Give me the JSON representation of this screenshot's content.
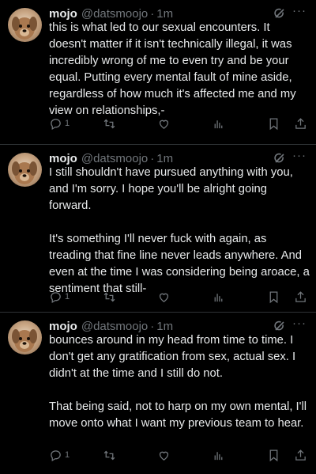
{
  "tweets": [
    {
      "name": "mojo",
      "handle": "@datsmoojo",
      "separator": "·",
      "time": "1m",
      "more": "···",
      "text": "this is what led to our sexual encounters. It doesn't matter if it isn't technically illegal, it was incredibly wrong of me to even try and be your equal. Putting every mental fault of mine aside, regardless of how much it's affected me and my view on relationships,-",
      "reply_count": "1"
    },
    {
      "name": "mojo",
      "handle": "@datsmoojo",
      "separator": "·",
      "time": "1m",
      "more": "···",
      "text": "I still shouldn't have pursued anything with you, and I'm sorry. I hope you'll be alright going forward.\n\nIt's something I'll never fuck with again, as treading that fine line never leads anywhere. And even at the time I was considering being aroace, a sentiment that still-",
      "reply_count": "1"
    },
    {
      "name": "mojo",
      "handle": "@datsmoojo",
      "separator": "·",
      "time": "1m",
      "more": "···",
      "text": "bounces around in my head from time to time. I don't get any gratification from sex, actual sex. I didn't at the time and I still do not.\n\nThat being said, not to harp on my own mental, I'll move onto what I want my previous team to hear.",
      "reply_count": "1"
    }
  ],
  "colors": {
    "background": "#000000",
    "text": "#e7e9ea",
    "muted": "#71767b",
    "divider": "#2f3336"
  },
  "icons": [
    "reply-icon",
    "retweet-icon",
    "like-icon",
    "views-icon",
    "bookmark-icon",
    "share-icon",
    "grok-icon",
    "more-icon"
  ]
}
